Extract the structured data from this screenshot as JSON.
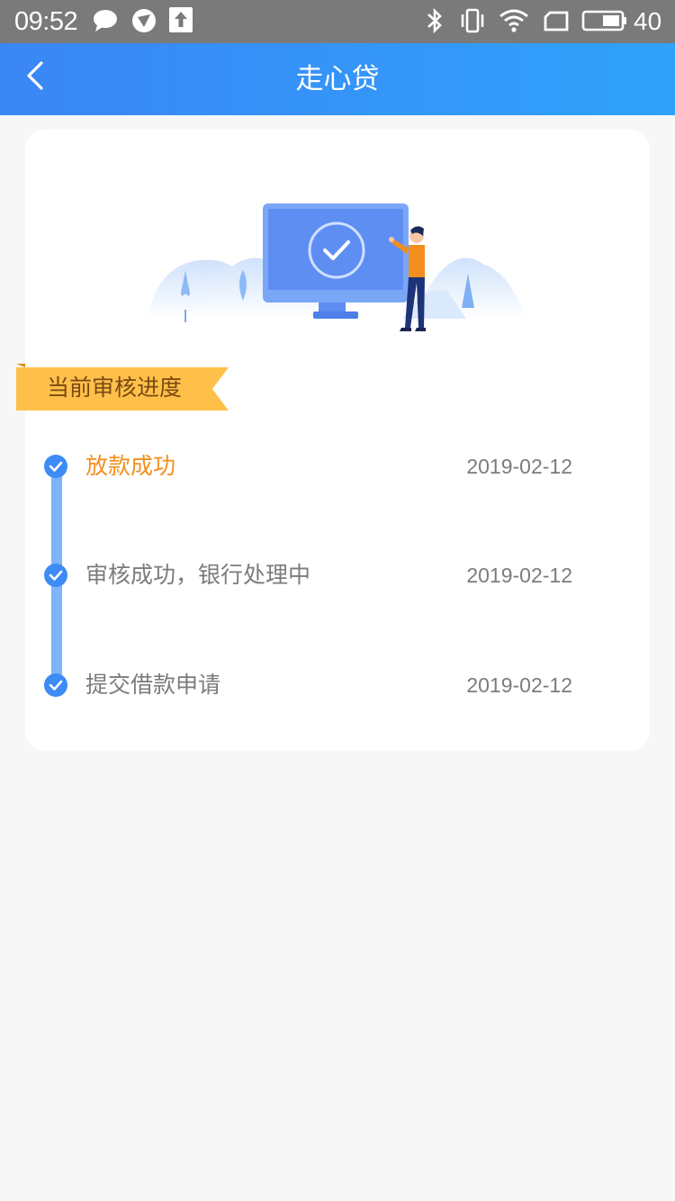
{
  "status_bar": {
    "time": "09:52",
    "battery_level": "40",
    "icons": [
      "chat-icon",
      "browser-icon",
      "upload-icon",
      "bluetooth-icon",
      "vibrate-icon",
      "wifi-icon",
      "sim-icon",
      "battery-icon"
    ]
  },
  "header": {
    "title": "走心贷",
    "back_icon": "chevron-left-icon"
  },
  "card": {
    "illustration": "monitor-check-illustration",
    "ribbon_label": "当前审核进度",
    "steps": [
      {
        "label": "放款成功",
        "date": "2019-02-12",
        "status": "active"
      },
      {
        "label": "审核成功，银行处理中",
        "date": "2019-02-12",
        "status": "done"
      },
      {
        "label": "提交借款申请",
        "date": "2019-02-12",
        "status": "done"
      }
    ]
  },
  "colors": {
    "header_start": "#3a86f5",
    "header_end": "#2fa2fb",
    "accent_orange": "#f28f1e",
    "timeline_blue": "#7db4fb",
    "check_blue": "#3d8bf5",
    "ribbon_yellow": "#ffc04a"
  }
}
